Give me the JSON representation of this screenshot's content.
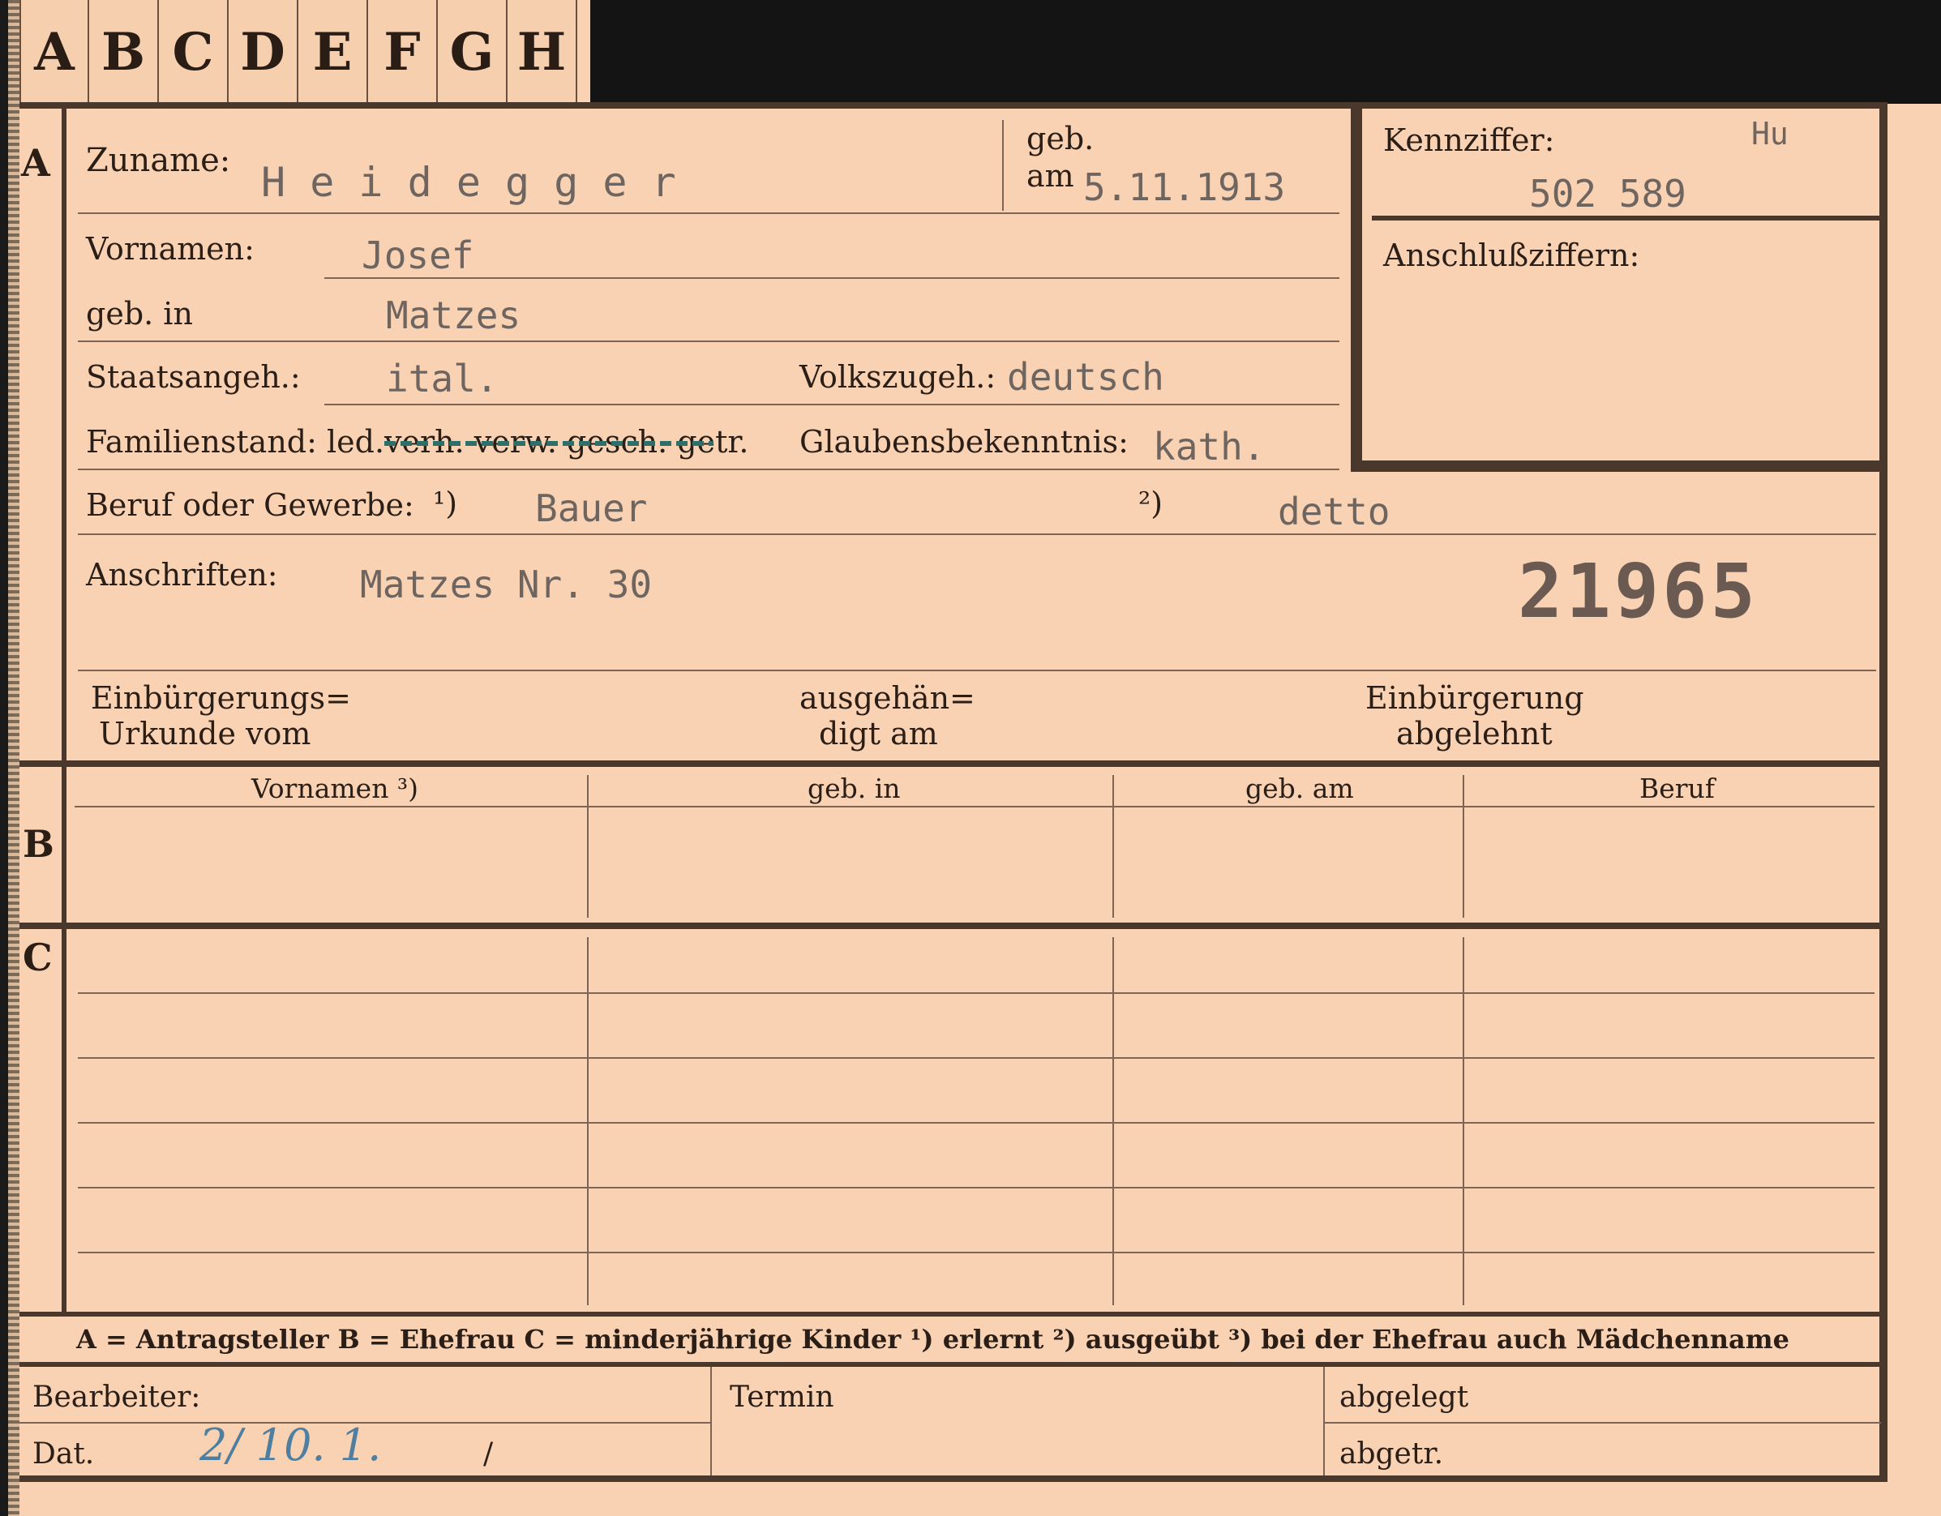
{
  "tabs": [
    "A",
    "B",
    "C",
    "D",
    "E",
    "F",
    "G",
    "H"
  ],
  "sections": {
    "a": "A",
    "b": "B",
    "c": "C"
  },
  "section_a": {
    "zuname_label": "Zuname:",
    "zuname_value": "H e i d e g g e r",
    "geb_label": "geb.",
    "am_label": "am",
    "geb_am_value": "5.11.1913",
    "kennziffer_label": "Kennziffer:",
    "kennziffer_note": "Hu",
    "kennziffer_value": "502 589",
    "anschluss_label": "Anschlußziffern:",
    "vornamen_label": "Vornamen:",
    "vornamen_value": "Josef",
    "geb_in_label": "geb. in",
    "geb_in_value": "Matzes",
    "staatsangeh_label": "Staatsangeh.:",
    "staatsangeh_value": "ital.",
    "volkszugeh_label": "Volkszugeh.:",
    "volkszugeh_value": "deutsch",
    "familienstand_label": "Familienstand: led.",
    "familienstand_value": "verh. verw. gesch. getr.",
    "glaubens_label": "Glaubensbekenntnis:",
    "glaubens_value": "kath.",
    "beruf_label": "Beruf oder Gewerbe:",
    "beruf_mark1": "¹)",
    "beruf_value1": "Bauer",
    "beruf_mark2": "²)",
    "beruf_value2": "detto",
    "anschriften_label": "Anschriften:",
    "anschriften_value": "Matzes Nr. 30",
    "stamp_number": "21965",
    "einb_urkunde_l1": "Einbürgerungs=",
    "einb_urkunde_l2": "Urkunde vom",
    "ausgeh_l1": "ausgehän=",
    "ausgeh_l2": "digt am",
    "einb_abgelehnt_l1": "Einbürgerung",
    "einb_abgelehnt_l2": "abgelehnt"
  },
  "table_headers": [
    "Vornamen ³)",
    "geb. in",
    "geb. am",
    "Beruf"
  ],
  "legend": "A = Antragsteller   B = Ehefrau   C = minderjährige Kinder   ¹) erlernt   ²) ausgeübt   ³) bei der Ehefrau auch Mädchenname",
  "footer": {
    "bearbeiter_label": "Bearbeiter:",
    "termin_label": "Termin",
    "abgelegt_label": "abgelegt",
    "dat_label": "Dat.",
    "dat_value": "2/ 10. 1.",
    "dat_slash": "/",
    "abgetr_label": "abgetr."
  }
}
